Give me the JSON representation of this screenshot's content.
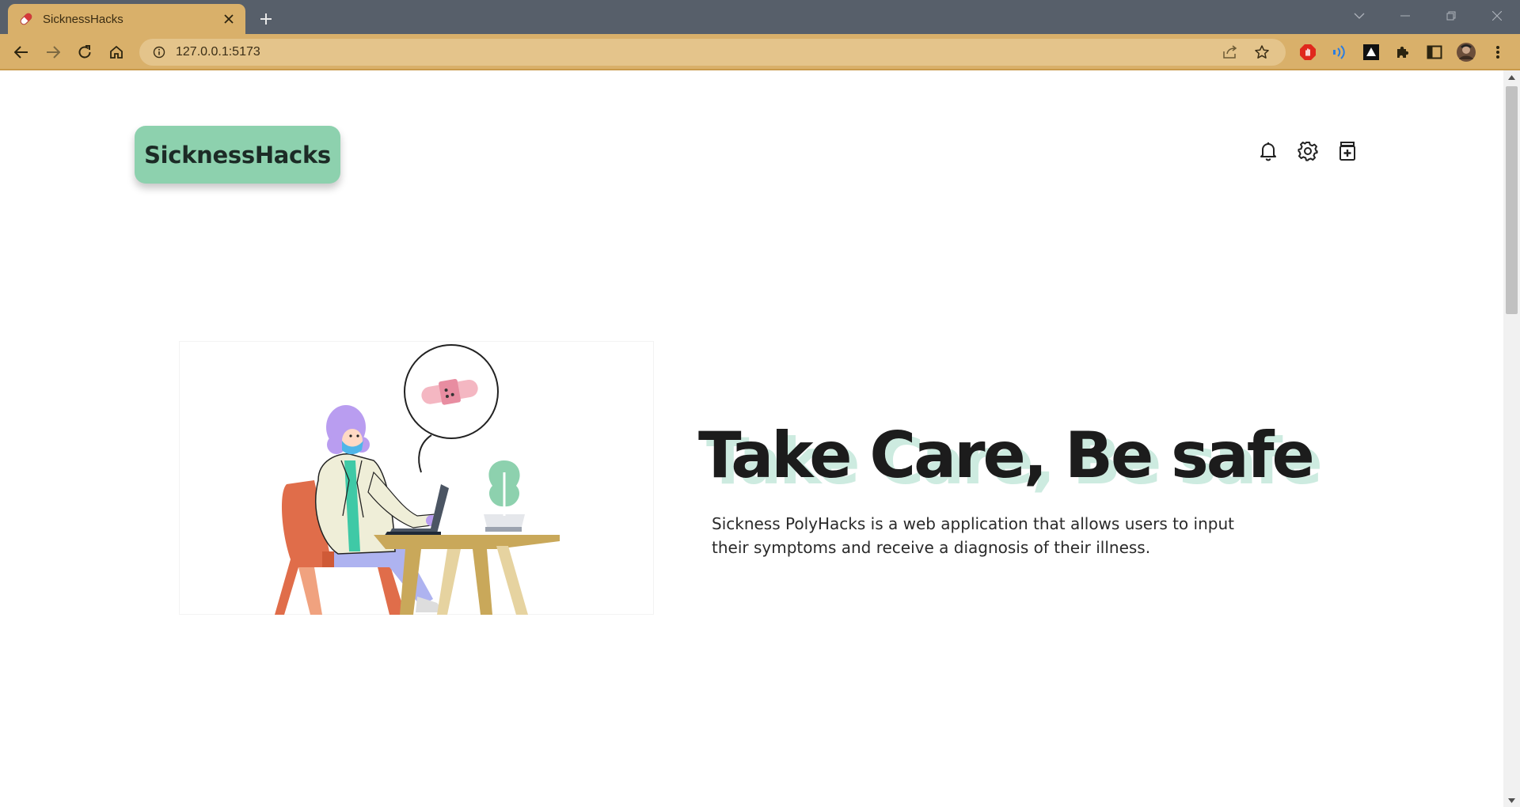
{
  "browser": {
    "tab_title": "SicknessHacks",
    "url": "127.0.0.1:5173",
    "colors": {
      "frame": "#575f6a",
      "toolbar": "#d9b06a",
      "omnibox": "#e4c48b"
    }
  },
  "page": {
    "logo_text": "SicknessHacks",
    "hero": {
      "title": "Take Care, Be safe",
      "description": "Sickness PolyHacks is a web application that allows users to input their symptoms and receive a diagnosis of their illness."
    },
    "colors": {
      "accent": "#8dd1ae",
      "title_shadow": "#cdebe0",
      "text": "#1c1c1c"
    },
    "icons": [
      "bell-icon",
      "gear-icon",
      "medicine-icon"
    ]
  }
}
